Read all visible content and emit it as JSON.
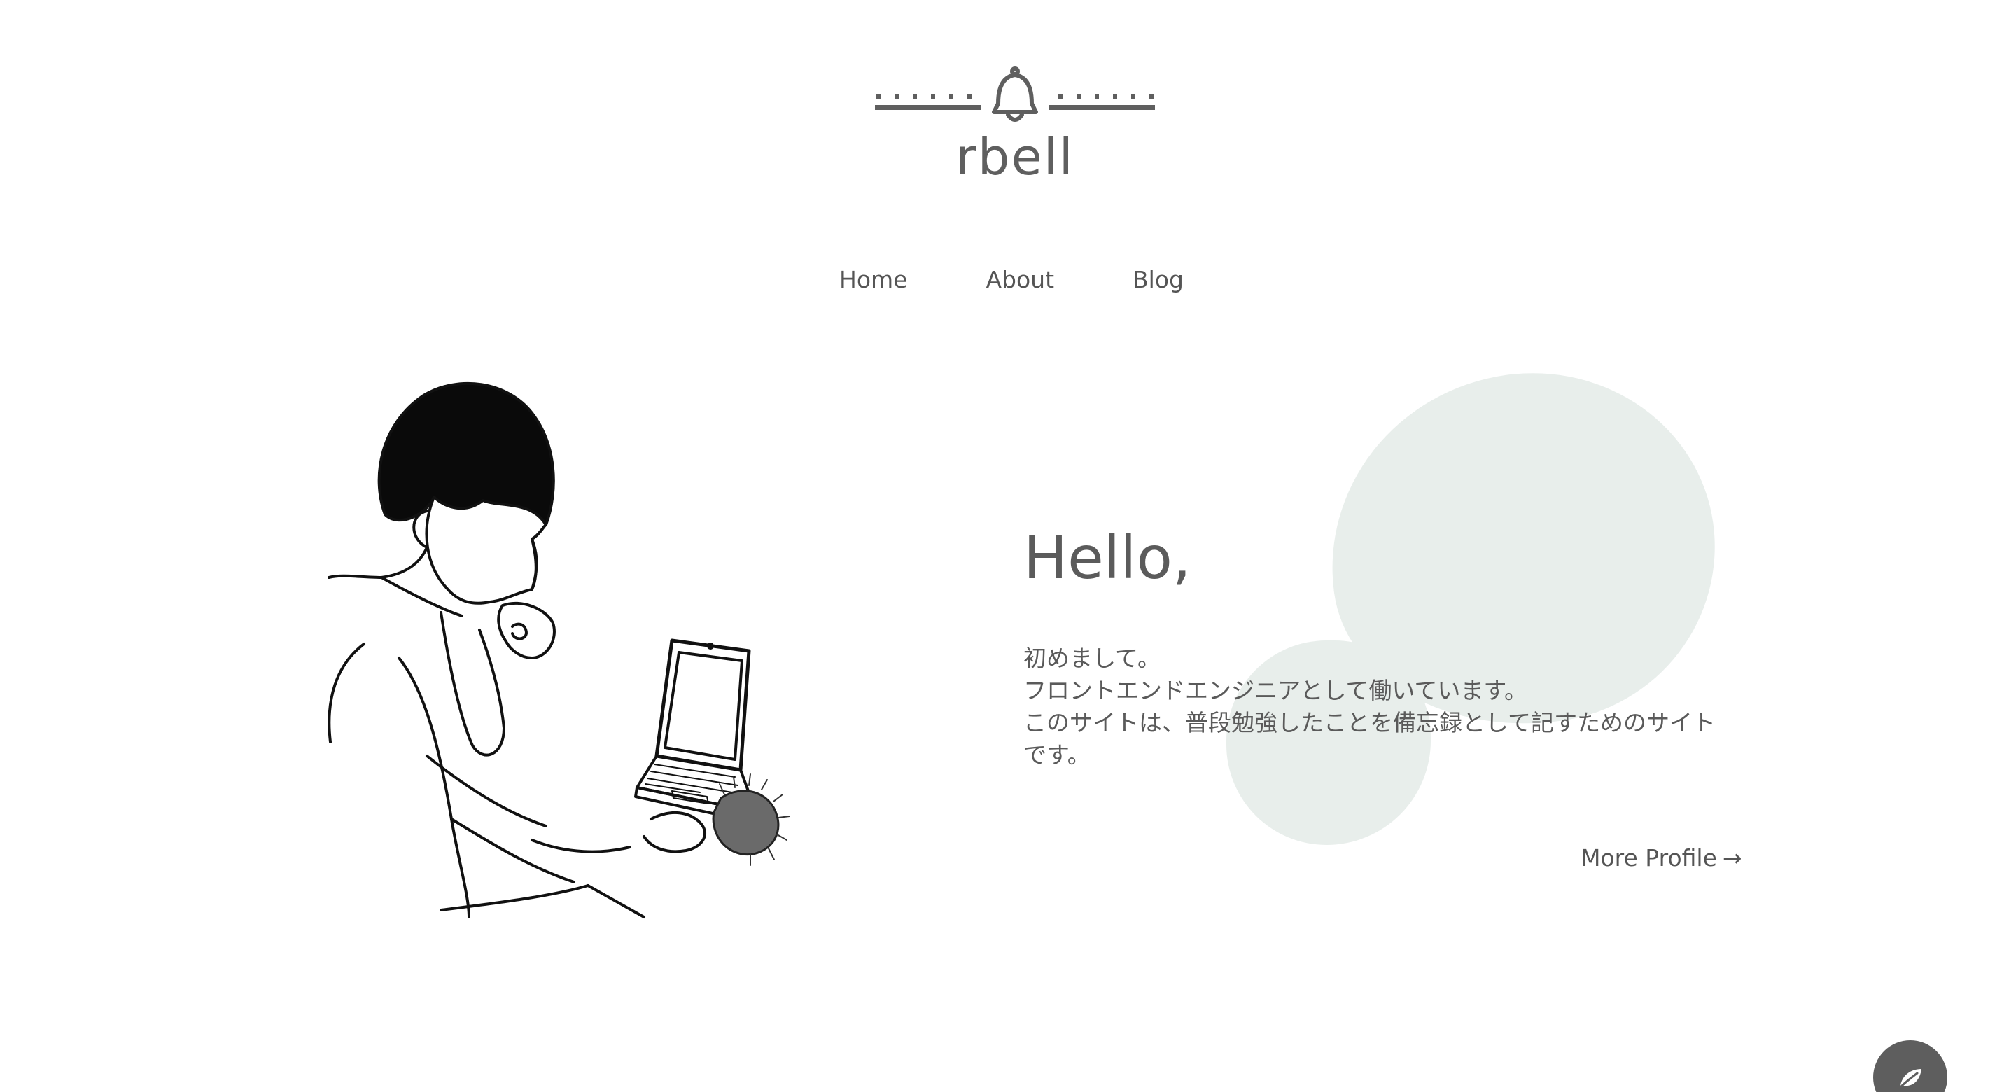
{
  "site": {
    "logo_text": "rbell",
    "logo_icon": "bell-icon"
  },
  "nav": {
    "items": [
      {
        "label": "Home"
      },
      {
        "label": "About"
      },
      {
        "label": "Blog"
      }
    ]
  },
  "hero": {
    "greeting": "Hello,",
    "intro_lines": [
      "初めまして。",
      "フロントエンドエンジニアとして働いています。",
      "このサイトは、普段勉強したことを備忘録として記すためのサイトです。"
    ],
    "more_profile_label": "More Profile",
    "more_profile_arrow": "→",
    "illustration": "person-with-laptop-and-hedgehog-illustration"
  },
  "fab": {
    "icon": "leaf-icon"
  },
  "colors": {
    "text": "#555555",
    "blob": "#e8eeeb",
    "fab": "#5e5e5e",
    "background": "#ffffff"
  }
}
